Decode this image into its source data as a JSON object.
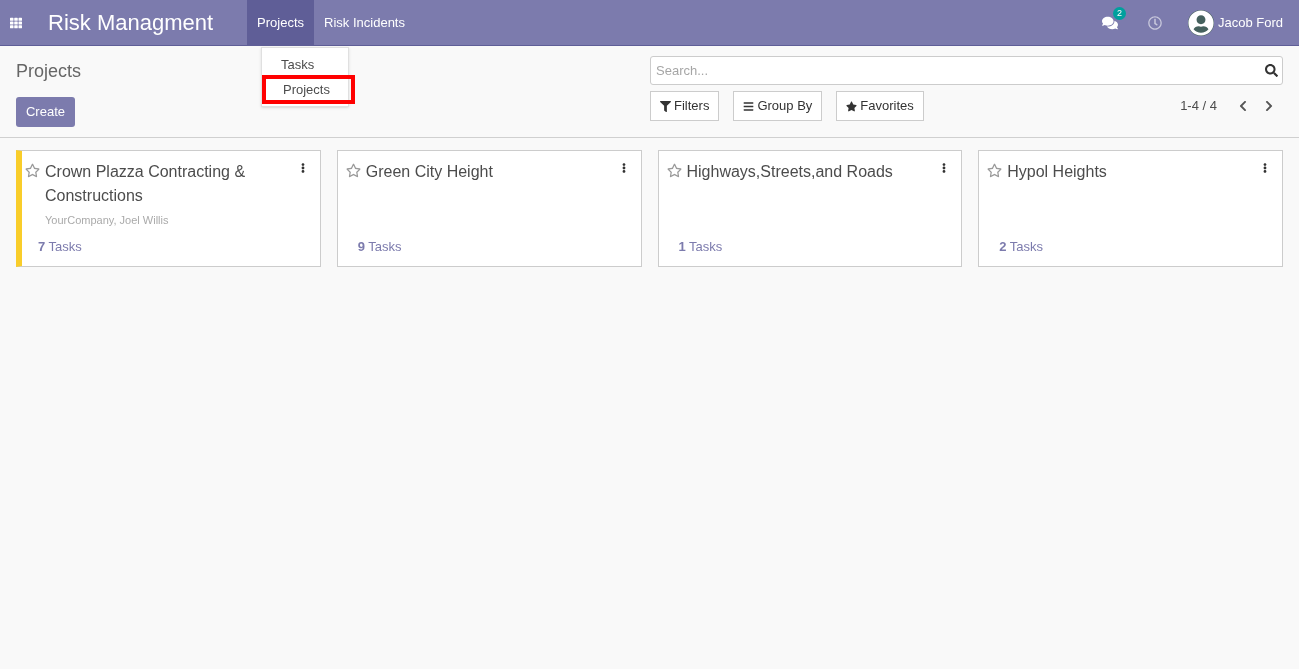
{
  "navbar": {
    "app_title": "Risk Managment",
    "menus": [
      {
        "label": "Projects",
        "selected": true
      },
      {
        "label": "Risk Incidents",
        "selected": false
      }
    ],
    "messages_count": "2",
    "user": "Jacob Ford"
  },
  "dropdown": {
    "items": [
      {
        "label": "Tasks",
        "highlighted": false
      },
      {
        "label": "Projects",
        "highlighted": true
      }
    ]
  },
  "control_panel": {
    "breadcrumb": "Projects",
    "create_button": "Create",
    "search": {
      "placeholder": "Search..."
    },
    "filters": [
      "Filters",
      "Group By",
      "Favorites"
    ],
    "pager": "1-4 / 4"
  },
  "projects": [
    {
      "name": "Crown Plazza Contracting & Constructions",
      "subtitle": "YourCompany, Joel Willis",
      "tasks": "**7** Tasks",
      "favorite": false,
      "color": "#f9cd2a"
    },
    {
      "name": "Green City Height",
      "tasks": "**9** Tasks",
      "favorite": false
    },
    {
      "name": "Highways,Streets,and Roads",
      "tasks": "**1** Tasks",
      "favorite": false
    },
    {
      "name": "Hypol Heights",
      "tasks": "**2** Tasks",
      "favorite": false
    }
  ]
}
